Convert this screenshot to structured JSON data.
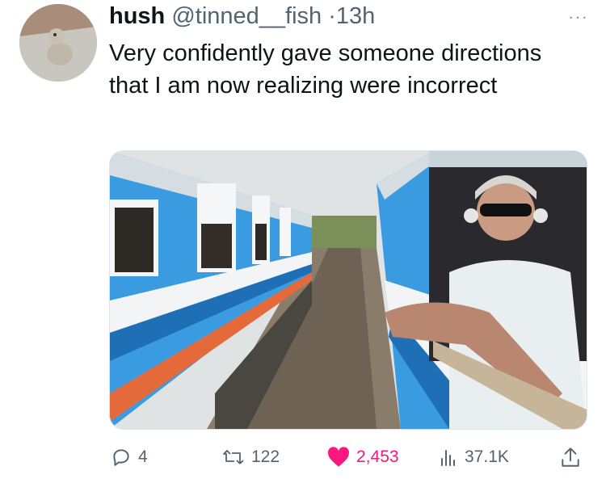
{
  "tweet": {
    "display_name": "hush",
    "handle": "@tinned__fish",
    "separator": "·",
    "time": "13h",
    "more": "···",
    "text": "Very confidently gave someone directions that I am now realizing were incorrect"
  },
  "actions": {
    "replies": "4",
    "retweets": "122",
    "likes": "2,453",
    "views": "37.1K"
  },
  "colors": {
    "like_active": "#f91880",
    "meta_gray": "#536471",
    "train_blue": "#3a9be0"
  },
  "icons": [
    "reply-icon",
    "retweet-icon",
    "heart-icon",
    "views-icon",
    "share-icon",
    "more-icon"
  ]
}
